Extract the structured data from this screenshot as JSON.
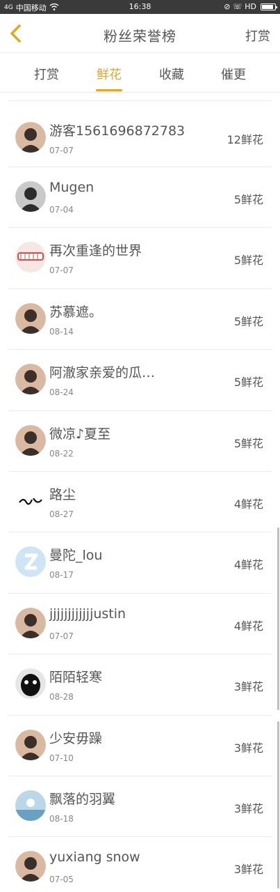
{
  "status": {
    "carrier": "中国移动",
    "signal": "4G",
    "time": "16:38",
    "right_icons": "⊘ ☏ HD"
  },
  "nav": {
    "title": "粉丝荣誉榜",
    "right_action": "打赏"
  },
  "tabs": [
    {
      "label": "打赏",
      "active": false
    },
    {
      "label": "鲜花",
      "active": true
    },
    {
      "label": "收藏",
      "active": false
    },
    {
      "label": "催更",
      "active": false
    }
  ],
  "accent_color": "#f0a21b",
  "fans": [
    {
      "name": "游客1561696872783",
      "date": "07-07",
      "count": "12鲜花",
      "avatar": "person-icon"
    },
    {
      "name": "Mugen",
      "date": "07-04",
      "count": "5鲜花",
      "avatar": "anime-icon"
    },
    {
      "name": "再次重逢的世界",
      "date": "07-07",
      "count": "5鲜花",
      "avatar": "teeth-icon"
    },
    {
      "name": "苏慕遮。",
      "date": "08-14",
      "count": "5鲜花",
      "avatar": "person-icon"
    },
    {
      "name": "阿澈家亲爱的瓜…",
      "date": "08-24",
      "count": "5鲜花",
      "avatar": "person-icon"
    },
    {
      "name": "微凉♪夏至",
      "date": "08-22",
      "count": "5鲜花",
      "avatar": "person-icon"
    },
    {
      "name": "路尘",
      "date": "08-27",
      "count": "4鲜花",
      "avatar": "calligraphy-icon"
    },
    {
      "name": "曼陀_lou",
      "date": "08-17",
      "count": "4鲜花",
      "avatar": "default-icon"
    },
    {
      "name": "jjjjjjjjjjjjustin",
      "date": "07-07",
      "count": "4鲜花",
      "avatar": "person-icon"
    },
    {
      "name": "陌陌轻寒",
      "date": "08-28",
      "count": "3鲜花",
      "avatar": "animal-icon"
    },
    {
      "name": "少安毋躁",
      "date": "07-10",
      "count": "3鲜花",
      "avatar": "person-icon"
    },
    {
      "name": "飘落的羽翼",
      "date": "08-18",
      "count": "3鲜花",
      "avatar": "scene-icon"
    },
    {
      "name": "yuxiang snow",
      "date": "07-05",
      "count": "3鲜花",
      "avatar": "person-icon"
    }
  ]
}
